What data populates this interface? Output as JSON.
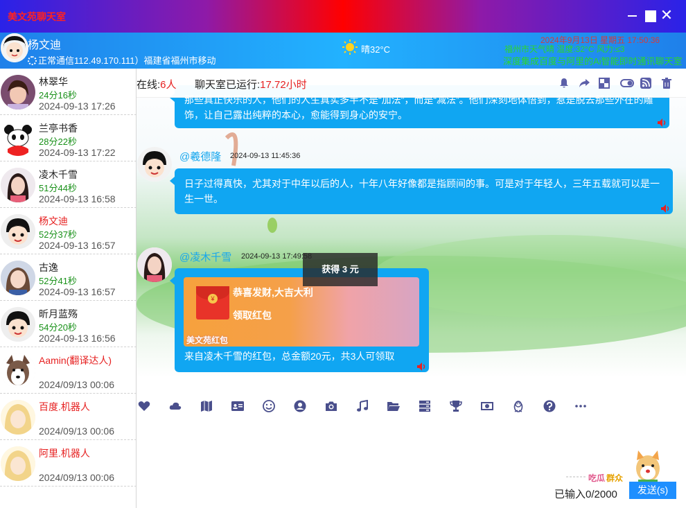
{
  "window": {
    "title": "美文苑聊天室"
  },
  "header": {
    "user_name": "杨文迪",
    "status": "正常通信112.49.170.111）福建省福州市移动",
    "weather": "晴32°C",
    "date_line": "2024年9月13日   星期五   17:50:36",
    "weather_line": "福州市天气晴 温度:32°C 风力:≤3",
    "marquee": "深度集成百度与阿里的Ai智能即时通讯聊天室"
  },
  "contacts": [
    {
      "name": "林翠华",
      "duration": "24分16秒",
      "time": "2024-09-13 17:26",
      "highlight": false
    },
    {
      "name": "兰亭书香",
      "duration": "28分22秒",
      "time": "2024-09-13 17:22",
      "highlight": false
    },
    {
      "name": "凌木千雪",
      "duration": "51分44秒",
      "time": "2024-09-13 16:58",
      "highlight": false
    },
    {
      "name": "杨文迪",
      "duration": "52分37秒",
      "time": "2024-09-13 16:57",
      "highlight": true
    },
    {
      "name": "古逸",
      "duration": "52分41秒",
      "time": "2024-09-13 16:57",
      "highlight": false
    },
    {
      "name": "昕月蓝殇",
      "duration": "54分20秒",
      "time": "2024-09-13 16:56",
      "highlight": false
    },
    {
      "name": "Aamin(翻译达人)",
      "duration": "",
      "time": "2024/09/13 00:06",
      "highlight": true
    },
    {
      "name": "百度.机器人",
      "duration": "",
      "time": "2024/09/13 00:06",
      "highlight": true
    },
    {
      "name": "阿里.机器人",
      "duration": "",
      "time": "2024/09/13 00:06",
      "highlight": true
    }
  ],
  "chat": {
    "online_label": "在线:",
    "online_count": "6人",
    "runtime_label": "聊天室已运行:",
    "runtime_value": "17.72小时",
    "msg0_text": "那些真正快乐的人，他们的人生真实多半不是“加法”，而是“减法”。他们深刻地体悟到，惹是脱去那些外在的雕饰，让自己露出纯粹的本心，愈能得到身心的安宁。",
    "msg1_user": "@羲德隆",
    "msg1_time": "2024-09-13 11:45:36",
    "msg1_text": "日子过得真快，尤其对于中年以后的人，十年八年好像都是指顾间的事。可是对于年轻人，三年五载就可以是一生一世。",
    "msg2_user": "@凌木千雪",
    "msg2_time": "2024-09-13 17:49:58",
    "redpack_title": "恭喜发财,大吉大利",
    "redpack_open": "领取红包",
    "redpack_brand": "美文苑红包",
    "redpack_desc": "来自凌木千雪的红包，总金额20元，共3人可领取",
    "toast": "获得 3 元"
  },
  "input": {
    "counter": "已输入0/2000",
    "send_label": "发送(s)"
  },
  "colors": {
    "accent": "#10a6f2",
    "titlebar_mid": "#ff0000",
    "online_red": "#e62020"
  }
}
